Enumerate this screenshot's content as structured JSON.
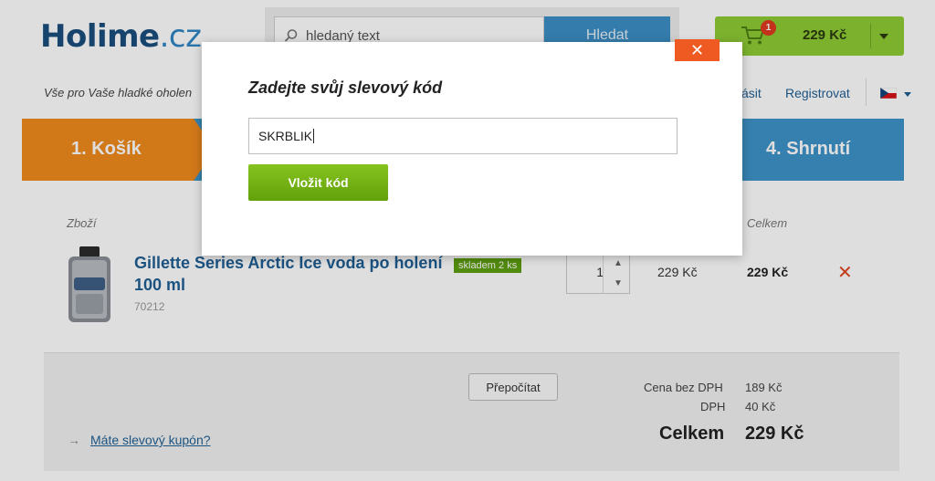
{
  "header": {
    "logo_main": "Holime",
    "logo_suffix": ".cz",
    "tagline": "Vše pro Vaše hladké oholen",
    "search": {
      "placeholder": "hledaný text",
      "button_label": "Hledat"
    },
    "cart": {
      "count": "1",
      "total": "229 Kč"
    },
    "login_label": "ásit",
    "register_label": "Registrovat",
    "language_icon": "czech-flag-icon"
  },
  "steps": {
    "step1": "1. Košík",
    "step4": "4. Shrnutí"
  },
  "table": {
    "col_goods": "Zboží",
    "col_total": "Celkem"
  },
  "product": {
    "name": "Gillette Series Arctic Ice voda po holení 100 ml",
    "stock": "skladem 2 ks",
    "code": "70212",
    "quantity": "1",
    "unit_price": "229 Kč",
    "line_total": "229 Kč",
    "remove_symbol": "✕"
  },
  "summary": {
    "recalc_label": "Přepočítat",
    "coupon_arrow": "→",
    "coupon_link": "Máte slevový kupón?",
    "net_label": "Cena bez DPH",
    "net_value": "189 Kč",
    "vat_label": "DPH",
    "vat_value": "40 Kč",
    "total_label": "Celkem",
    "total_value": "229 Kč"
  },
  "modal": {
    "close_symbol": "✕",
    "title": "Zadejte svůj slevový kód",
    "input_value": "SKRBLIK",
    "submit_label": "Vložit kód"
  },
  "colors": {
    "brand_blue": "#1a4f7e",
    "step_orange": "#f08a1c",
    "step_blue": "#3e93c9",
    "cart_green": "#8fcc35",
    "close_orange": "#ee5a22",
    "submit_green": "#6fb014"
  }
}
